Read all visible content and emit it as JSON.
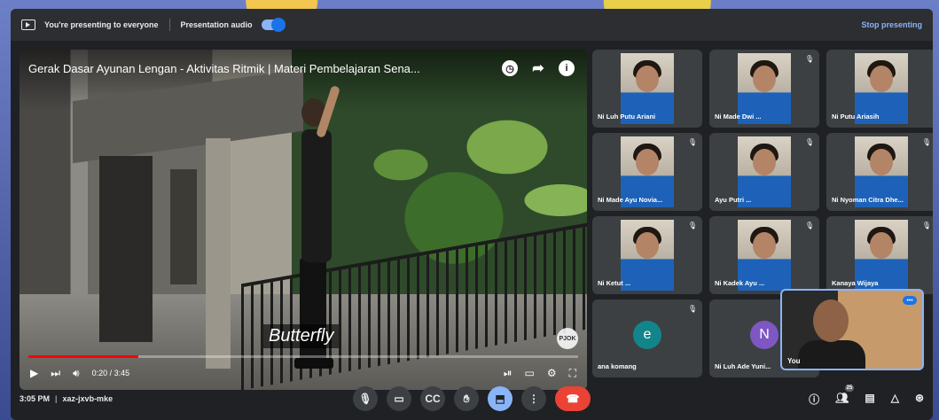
{
  "topbar": {
    "presenting_text": "You're presenting to everyone",
    "audio_label": "Presentation audio",
    "audio_enabled": true,
    "stop_label": "Stop presenting"
  },
  "video": {
    "title": "Gerak Dasar Ayunan Lengan - Aktivitas Ritmik | Materi Pembelajaran Sena...",
    "caption": "Butterfly",
    "time_label": "0:20 / 3:45",
    "progress_fraction": 0.2,
    "top_icons": [
      "clock-icon",
      "share-icon",
      "info-icon"
    ]
  },
  "participants": [
    {
      "name": "Ni Luh Putu Ariani",
      "muted": false
    },
    {
      "name": "Ni Made Dwi ...",
      "muted": true
    },
    {
      "name": "Ni Putu Ariasih",
      "muted": false
    },
    {
      "name": "Ni Made Ayu Novia...",
      "muted": true
    },
    {
      "name": "Ayu Putri ...",
      "muted": true
    },
    {
      "name": "Ni Nyoman Citra Dhe...",
      "muted": true
    },
    {
      "name": "Ni Ketut ...",
      "muted": true
    },
    {
      "name": "Ni Kadek Ayu ...",
      "muted": true
    },
    {
      "name": "Kanaya Wijaya",
      "muted": true
    },
    {
      "name": "ana komang",
      "muted": true,
      "avatar_letter": "e",
      "avatar_color": "#12858a"
    },
    {
      "name": "Ni Luh Ade Yuni...",
      "muted": true,
      "avatar_letter": "N",
      "avatar_color": "#7e57c2"
    }
  ],
  "self_view": {
    "name": "You",
    "more_label": "•••"
  },
  "bottombar": {
    "time": "3:05 PM",
    "meeting_code": "xaz-jxvb-mke",
    "people_count": "25"
  }
}
